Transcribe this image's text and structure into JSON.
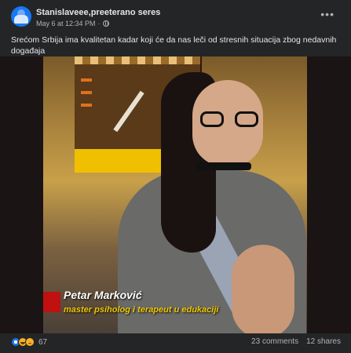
{
  "post": {
    "author": "Stanislaveee,preeterano seres",
    "timestamp": "May 6 at 12:34 PM",
    "caption": "Srećom Srbija ima kvalitetan kadar koji će da nas leči od stresnih situacija zbog nedavnih događaja"
  },
  "video": {
    "lower_third_name": "Petar Marković",
    "lower_third_title": "master psiholog i terapeut u edukaciji"
  },
  "footer": {
    "reactions": [
      "like",
      "haha",
      "sad"
    ],
    "reaction_count": "67",
    "comments": "23 comments",
    "shares": "12 shares"
  },
  "colors": {
    "background": "#242526",
    "text_primary": "#e4e6eb",
    "text_secondary": "#b0b3b8",
    "accent": "#1877f2",
    "lower_third_title": "#f0c800"
  },
  "icons": {
    "privacy": "globe-icon",
    "menu": "more-options-icon"
  }
}
